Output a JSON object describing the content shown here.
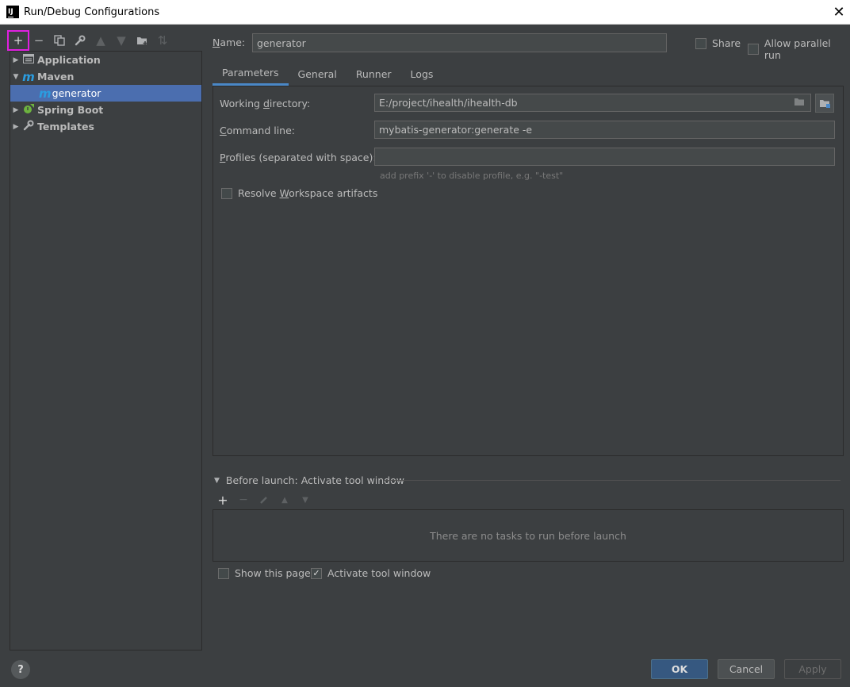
{
  "window": {
    "title": "Run/Debug Configurations",
    "app_icon": "IJ"
  },
  "toolbar": {
    "add": "+",
    "remove": "−",
    "copy": "⧉",
    "edit": "🔧",
    "up": "▲",
    "down": "▼",
    "folder": "▬",
    "sort": "⇅"
  },
  "tree": {
    "items": [
      {
        "label": "Application",
        "icon": "application-icon"
      },
      {
        "label": "Maven",
        "icon": "maven-icon"
      },
      {
        "label": "generator",
        "icon": "maven-icon"
      },
      {
        "label": "Spring Boot",
        "icon": "spring-boot-icon"
      },
      {
        "label": "Templates",
        "icon": "wrench-icon"
      }
    ]
  },
  "header": {
    "name_label_first": "N",
    "name_label_rest": "ame:",
    "name_value": "generator",
    "share_label": "Share",
    "parallel_label": "Allow parallel run"
  },
  "tabs": [
    "Parameters",
    "General",
    "Runner",
    "Logs"
  ],
  "params": {
    "working_dir_label_a": "Working ",
    "working_dir_label_u": "d",
    "working_dir_label_b": "irectory:",
    "working_dir_value": "E:/project/ihealth/ihealth-db",
    "cmd_label_u": "C",
    "cmd_label_rest": "ommand line:",
    "cmd_value": "mybatis-generator:generate -e",
    "profiles_label_u": "P",
    "profiles_label_rest": "rofiles (separated with space):",
    "profiles_value": "",
    "profiles_hint": "add prefix '-' to disable profile, e.g. \"-test\"",
    "resolve_label_a": "Resolve ",
    "resolve_label_u": "W",
    "resolve_label_b": "orkspace artifacts"
  },
  "before_launch": {
    "title": "Before launch: Activate tool window",
    "empty_text": "There are no tasks to run before launch"
  },
  "bottom": {
    "show_page_label": "Show this page",
    "activate_label": "Activate tool window"
  },
  "buttons": {
    "help": "?",
    "ok": "OK",
    "cancel": "Cancel",
    "apply": "Apply"
  },
  "colors": {
    "accent": "#4b6eaf",
    "highlight": "#e020e0",
    "primary_button": "#365880"
  }
}
